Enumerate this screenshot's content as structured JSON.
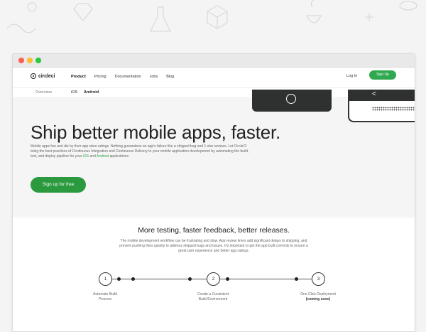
{
  "colors": {
    "accent": "#2fa84f",
    "dark": "#2f3030",
    "close_dot": "#fd5f57",
    "min_dot": "#febc2e",
    "max_dot": "#28c840"
  },
  "nav": {
    "logo": "circleci",
    "menu": [
      "Product",
      "Pricing",
      "Documentation",
      "Jobs",
      "Blog"
    ],
    "login": "Log In",
    "signup": "Sign Up"
  },
  "subnav": {
    "overview": "Overview",
    "ios": "iOS",
    "android": "Android"
  },
  "hero": {
    "headline": "Ship better mobile apps, faster.",
    "desc_part1": "Mobile apps live and die by their app store ratings. Nothing guarantees an app's failure like a shipped bug and 1-star reviews. Let CircleCI bring the best practices of Continuous Integration and Continuous Delivery to your mobile application development by automating the build, test, and deploy pipeline for your ",
    "desc_ios": "iOS",
    "desc_and": " and ",
    "desc_android": "Android",
    "desc_end": " applications.",
    "cta": "Sign up for free",
    "phone_back": "<"
  },
  "features": {
    "title": "More testing, faster feedback, better releases.",
    "desc": "The mobile development workflow can be frustrating and slow. App review times add significant delays to shipping, and prevent pushing fixes quickly to address shipped bugs and issues. It's important to get the app built correctly to ensure a great user experience and better app ratings.",
    "steps": [
      {
        "number": "1",
        "label_line1": "Automate Build",
        "label_line2": "Process"
      },
      {
        "number": "2",
        "label_line1": "Create a Consistent",
        "label_line2": "Build Environment"
      },
      {
        "number": "3",
        "label_line1": "One Click Deployment",
        "label_line2": "(coming soon)"
      }
    ]
  }
}
